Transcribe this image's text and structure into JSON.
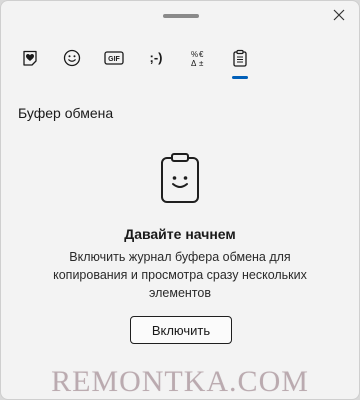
{
  "window": {
    "close_symbol": "✕"
  },
  "tabs": [
    {
      "name": "favorites",
      "icon": "heart-sticker-icon"
    },
    {
      "name": "emoji",
      "icon": "smiley-icon"
    },
    {
      "name": "gif",
      "icon": "gif-icon",
      "label": "GIF"
    },
    {
      "name": "kaomoji",
      "icon": "kaomoji-icon",
      "label": ";-)"
    },
    {
      "name": "symbols",
      "icon": "symbols-icon"
    },
    {
      "name": "clipboard",
      "icon": "clipboard-icon",
      "active": true
    }
  ],
  "section": {
    "title": "Буфер обмена"
  },
  "empty_state": {
    "title": "Давайте начнем",
    "description": "Включить журнал буфера обмена для копирования и просмотра сразу нескольких элементов",
    "button_label": "Включить"
  },
  "watermark": {
    "text": "REMONTKA.COM"
  },
  "colors": {
    "accent": "#005fb8",
    "background": "#f3f3f3"
  }
}
